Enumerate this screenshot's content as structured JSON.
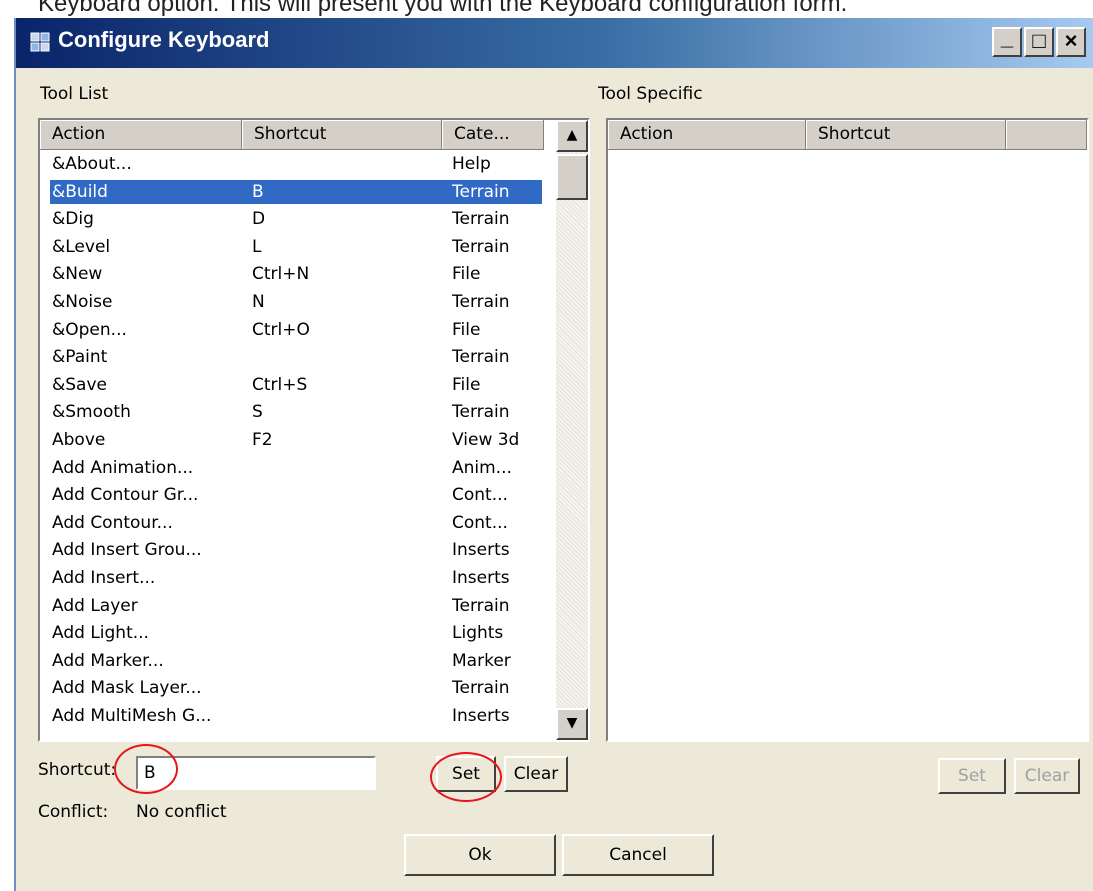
{
  "document_text": "Keyboard option.  This will present you with the Keyboard configuration form.",
  "window": {
    "title": "Configure Keyboard",
    "controls": {
      "minimize": "_",
      "maximize": "□",
      "close": "×"
    }
  },
  "tool_list": {
    "label": "Tool List",
    "columns": {
      "action": "Action",
      "shortcut": "Shortcut",
      "category": "Cate..."
    },
    "rows": [
      {
        "action": "&About...",
        "shortcut": "",
        "category": "Help"
      },
      {
        "action": "&Build",
        "shortcut": "B",
        "category": "Terrain",
        "selected": true
      },
      {
        "action": "&Dig",
        "shortcut": "D",
        "category": "Terrain"
      },
      {
        "action": "&Level",
        "shortcut": "L",
        "category": "Terrain"
      },
      {
        "action": "&New",
        "shortcut": "Ctrl+N",
        "category": "File"
      },
      {
        "action": "&Noise",
        "shortcut": "N",
        "category": "Terrain"
      },
      {
        "action": "&Open...",
        "shortcut": "Ctrl+O",
        "category": "File"
      },
      {
        "action": "&Paint",
        "shortcut": "",
        "category": "Terrain"
      },
      {
        "action": "&Save",
        "shortcut": "Ctrl+S",
        "category": "File"
      },
      {
        "action": "&Smooth",
        "shortcut": "S",
        "category": "Terrain"
      },
      {
        "action": "Above",
        "shortcut": "F2",
        "category": "View 3d"
      },
      {
        "action": "Add Animation...",
        "shortcut": "",
        "category": "Anim..."
      },
      {
        "action": "Add Contour Gr...",
        "shortcut": "",
        "category": "Cont..."
      },
      {
        "action": "Add Contour...",
        "shortcut": "",
        "category": "Cont..."
      },
      {
        "action": "Add Insert Grou...",
        "shortcut": "",
        "category": "Inserts"
      },
      {
        "action": "Add Insert...",
        "shortcut": "",
        "category": "Inserts"
      },
      {
        "action": "Add Layer",
        "shortcut": "",
        "category": "Terrain"
      },
      {
        "action": "Add Light...",
        "shortcut": "",
        "category": "Lights"
      },
      {
        "action": "Add Marker...",
        "shortcut": "",
        "category": "Marker"
      },
      {
        "action": "Add Mask Layer...",
        "shortcut": "",
        "category": "Terrain"
      },
      {
        "action": "Add MultiMesh G...",
        "shortcut": "",
        "category": "Inserts"
      }
    ],
    "scroll_up": "▲",
    "scroll_down": "▼"
  },
  "tool_specific": {
    "label": "Tool Specific",
    "columns": {
      "action": "Action",
      "shortcut": "Shortcut"
    }
  },
  "shortcut": {
    "label": "Shortcut:",
    "value": "B"
  },
  "conflict": {
    "label": "Conflict:",
    "value": "No conflict"
  },
  "buttons": {
    "set": "Set",
    "clear": "Clear",
    "specific_set": "Set",
    "specific_clear": "Clear",
    "ok": "Ok",
    "cancel": "Cancel"
  },
  "colors": {
    "selection": "#316ac5",
    "annotation": "#e8141e",
    "face": "#ece9d8"
  }
}
